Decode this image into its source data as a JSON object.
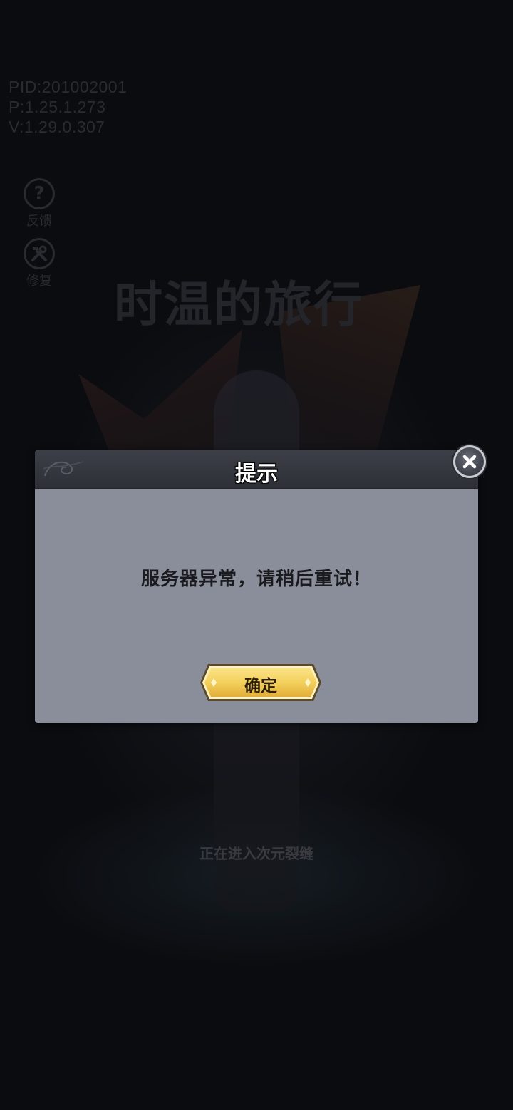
{
  "info": {
    "pid": "PID:201002001",
    "p_version": "P:1.25.1.273",
    "v_version": "V:1.29.0.307"
  },
  "side_menu": {
    "feedback_label": "反馈",
    "feedback_icon": "question-icon",
    "repair_label": "修复",
    "repair_icon": "wrench-hammer-icon"
  },
  "game_title": "时温的旅行",
  "loading_text": "正在进入次元裂缝",
  "dialog": {
    "title": "提示",
    "message": "服务器异常，请稍后重试！",
    "confirm_label": "确定",
    "close_icon": "close-icon"
  },
  "colors": {
    "dialog_body": "#8a8e9a",
    "dialog_header": "#33363e",
    "confirm_button": "#f3cf5c"
  }
}
